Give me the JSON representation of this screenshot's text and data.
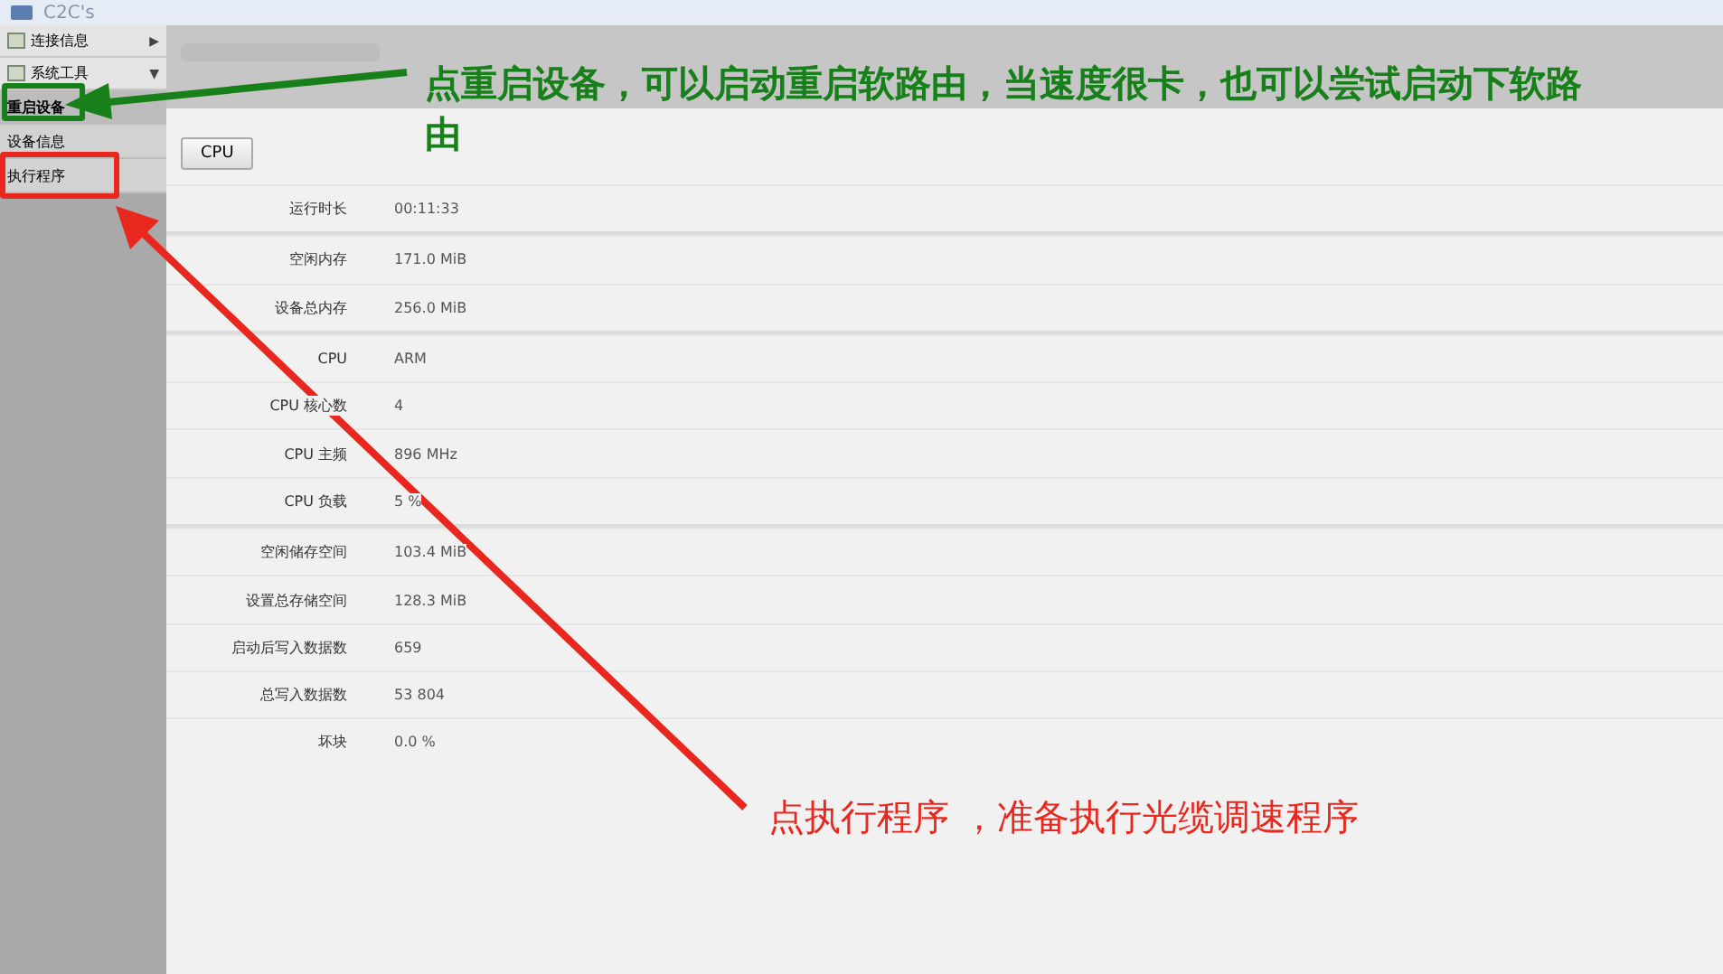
{
  "window": {
    "title": "C2C's"
  },
  "sidebar": {
    "items": [
      {
        "label": "连接信息",
        "caret": "▶",
        "kind": "group"
      },
      {
        "label": "系统工具",
        "caret": "▼",
        "kind": "group"
      },
      {
        "label": "重启设备",
        "kind": "item",
        "selected": true
      },
      {
        "label": "设备信息",
        "kind": "item",
        "selected": false
      },
      {
        "label": "执行程序",
        "kind": "item",
        "selected": false
      }
    ]
  },
  "toolbar": {
    "buttons": [
      "CPU"
    ]
  },
  "stats": [
    {
      "label": "运行时长",
      "value": "00:11:33",
      "divider": true
    },
    {
      "label": "空闲内存",
      "value": "171.0 MiB",
      "divider": false
    },
    {
      "label": "设备总内存",
      "value": "256.0 MiB",
      "divider": true
    },
    {
      "label": "CPU",
      "value": "ARM",
      "divider": false
    },
    {
      "label": "CPU 核心数",
      "value": "4",
      "divider": false
    },
    {
      "label": "CPU 主频",
      "value": "896 MHz",
      "divider": false
    },
    {
      "label": "CPU 负载",
      "value": "5 %",
      "divider": true
    },
    {
      "label": "空闲储存空间",
      "value": "103.4 MiB",
      "divider": false
    },
    {
      "label": "设置总存储空间",
      "value": "128.3 MiB",
      "divider": false
    },
    {
      "label": "启动后写入数据数",
      "value": "659",
      "divider": false
    },
    {
      "label": "总写入数据数",
      "value": "53 804",
      "divider": false
    },
    {
      "label": "坏块",
      "value": "0.0 %",
      "divider": false
    }
  ],
  "annotations": [
    {
      "text": "点重启设备，可以启动重启软路由，当速度很卡，也可以尝试启动下软路由",
      "color": "#17801a"
    },
    {
      "text": "点执行程序 ，准备执行光缆调速程序",
      "color": "#e8281e"
    }
  ]
}
